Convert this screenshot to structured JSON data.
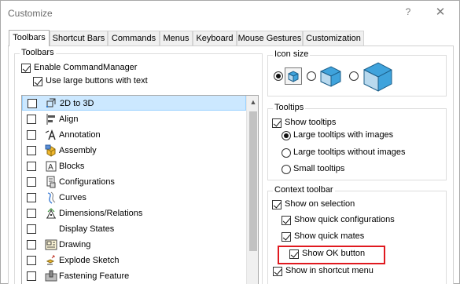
{
  "window": {
    "title": "Customize",
    "help_glyph": "?",
    "close_glyph": "✕"
  },
  "tabs": [
    {
      "label": "Toolbars",
      "active": true
    },
    {
      "label": "Shortcut Bars",
      "active": false
    },
    {
      "label": "Commands",
      "active": false
    },
    {
      "label": "Menus",
      "active": false
    },
    {
      "label": "Keyboard",
      "active": false
    },
    {
      "label": "Mouse Gestures",
      "active": false
    },
    {
      "label": "Customization",
      "active": false
    }
  ],
  "toolbars_group": {
    "legend": "Toolbars",
    "enable_commandmanager": {
      "label": "Enable CommandManager",
      "checked": true
    },
    "use_large_buttons": {
      "label": "Use large buttons with text",
      "checked": true
    },
    "items": [
      {
        "label": "2D to 3D",
        "icon": "2d-to-3d-icon",
        "checked": false,
        "selected": true
      },
      {
        "label": "Align",
        "icon": "align-icon",
        "checked": false,
        "selected": false
      },
      {
        "label": "Annotation",
        "icon": "annotation-icon",
        "checked": false,
        "selected": false
      },
      {
        "label": "Assembly",
        "icon": "assembly-icon",
        "checked": false,
        "selected": false
      },
      {
        "label": "Blocks",
        "icon": "blocks-icon",
        "checked": false,
        "selected": false
      },
      {
        "label": "Configurations",
        "icon": "configurations-icon",
        "checked": false,
        "selected": false
      },
      {
        "label": "Curves",
        "icon": "curves-icon",
        "checked": false,
        "selected": false
      },
      {
        "label": "Dimensions/Relations",
        "icon": "dimensions-relations-icon",
        "checked": false,
        "selected": false
      },
      {
        "label": "Display States",
        "icon": "",
        "checked": false,
        "selected": false
      },
      {
        "label": "Drawing",
        "icon": "drawing-icon",
        "checked": false,
        "selected": false
      },
      {
        "label": "Explode Sketch",
        "icon": "explode-sketch-icon",
        "checked": false,
        "selected": false
      },
      {
        "label": "Fastening Feature",
        "icon": "fastening-feature-icon",
        "checked": false,
        "selected": false
      }
    ]
  },
  "icon_size": {
    "legend": "Icon size",
    "options": [
      {
        "size": "small",
        "checked": true,
        "icon": "cube-small-icon"
      },
      {
        "size": "medium",
        "checked": false,
        "icon": "cube-medium-icon"
      },
      {
        "size": "large",
        "checked": false,
        "icon": "cube-large-icon"
      }
    ]
  },
  "tooltips": {
    "legend": "Tooltips",
    "show_tooltips": {
      "label": "Show tooltips",
      "checked": true
    },
    "options": [
      {
        "label": "Large tooltips with images",
        "checked": true
      },
      {
        "label": "Large tooltips without images",
        "checked": false
      },
      {
        "label": "Small tooltips",
        "checked": false
      }
    ]
  },
  "context_toolbar": {
    "legend": "Context toolbar",
    "show_on_selection": {
      "label": "Show on selection",
      "checked": true
    },
    "show_quick_configurations": {
      "label": "Show quick configurations",
      "checked": true
    },
    "show_quick_mates": {
      "label": "Show quick mates",
      "checked": true
    },
    "show_ok_button": {
      "label": "Show OK button",
      "checked": true
    },
    "show_in_shortcut_menu": {
      "label": "Show in shortcut menu",
      "checked": true
    }
  },
  "colors": {
    "selection_bg": "#cce8ff",
    "highlight_red": "#e0191f",
    "cube_blue": "#3fa3dc"
  }
}
